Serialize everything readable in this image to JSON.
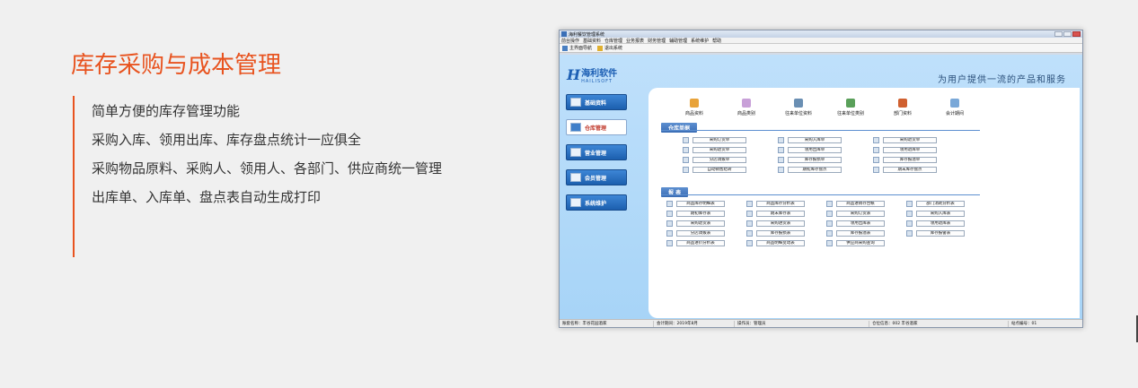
{
  "left": {
    "title": "库存采购与成本管理",
    "features": [
      "简单方便的库存管理功能",
      "采购入库、领用出库、库存盘点统计一应俱全",
      "采购物品原料、采购人、领用人、各部门、供应商统一管理",
      "出库单、入库单、盘点表自动生成打印"
    ],
    "accent_color": "#e8531f"
  },
  "app": {
    "window_title": "海利餐饮管理系统",
    "menu": [
      "前台操作",
      "基础资料",
      "仓库管理",
      "业务报表",
      "财务管理",
      "辅助管理",
      "系统维护",
      "帮助"
    ],
    "toolbar": [
      {
        "label": "主界面导航",
        "icon": "home-icon"
      },
      {
        "label": "退出系统",
        "icon": "exit-icon"
      }
    ],
    "logo": {
      "mark": "H",
      "cn": "海利软件",
      "en": "HAILISOFT"
    },
    "slogan": "为用户提供一流的产品和服务",
    "nav": [
      {
        "label": "基础资料",
        "icon": "chart-icon",
        "active": false
      },
      {
        "label": "仓库管理",
        "icon": "warehouse-icon",
        "active": true
      },
      {
        "label": "营业管理",
        "icon": "screen-icon",
        "active": false
      },
      {
        "label": "会员管理",
        "icon": "member-card-icon",
        "active": false
      },
      {
        "label": "系统维护",
        "icon": "tools-icon",
        "active": false
      }
    ],
    "top_items": [
      {
        "label": "商品资料",
        "color": "#e8a33a"
      },
      {
        "label": "商品类别",
        "color": "#c8a0d8"
      },
      {
        "label": "往来单位资料",
        "color": "#6a8fb3"
      },
      {
        "label": "往来单位类别",
        "color": "#5aa05a"
      },
      {
        "label": "部门资料",
        "color": "#d06030"
      },
      {
        "label": "会计期间",
        "color": "#7aa8d8"
      }
    ],
    "docs_title": "仓库单据",
    "docs": [
      [
        "采购订货单",
        "采购入库单",
        "采购退货单"
      ],
      [
        "采购退货单",
        "领用出库单",
        "领用退库单"
      ],
      [
        "分店调拨单",
        "库存报损单",
        "库存报溢单"
      ],
      [
        "自动销售结转",
        "期初库存盘点",
        "期末库存盘点"
      ]
    ],
    "reports_title": "报 表",
    "reports": [
      [
        "商品库存明细表",
        "商品库存分析表",
        "商品进销存台帐",
        "部门消耗分析表"
      ],
      [
        "期初库存表",
        "期末库存表",
        "采购订货表",
        "采购入库表"
      ],
      [
        "采购退货表",
        "采购进货表",
        "领用出库表",
        "领用退库表"
      ],
      [
        "分店调拨表",
        "库存报损表",
        "库存报溢表",
        "库存报警表"
      ],
      [
        "商品进价分析表",
        "商品明细变动表",
        "供应商采购查询"
      ]
    ],
    "status": [
      "账套名称：丰谷花园酒家",
      "会计期间：2019年8月",
      "操作员：管理员",
      "仓位信息：002 丰谷酒家",
      "站点编号：01"
    ]
  }
}
